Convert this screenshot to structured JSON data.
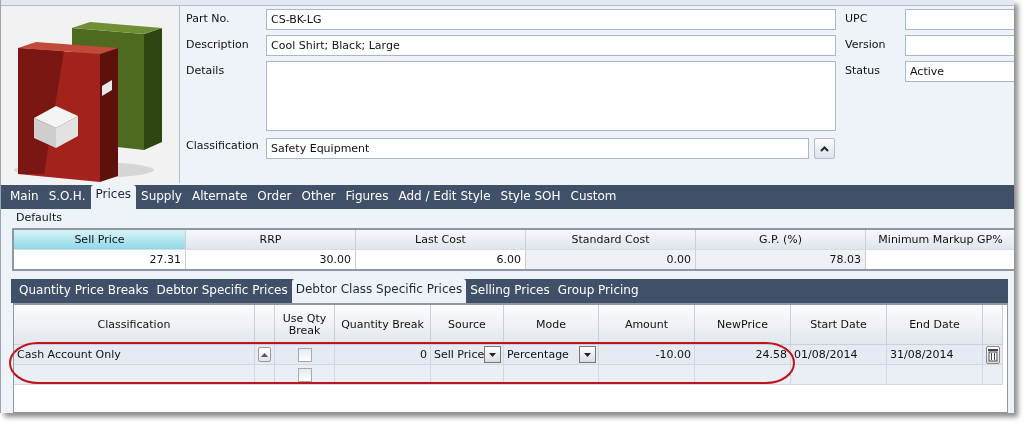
{
  "product": {
    "fields": [
      {
        "label": "Part No.",
        "value": "CS-BK-LG",
        "kind": "text"
      },
      {
        "label": "Description",
        "value": "Cool Shirt; Black; Large",
        "kind": "text"
      },
      {
        "label": "Details",
        "kind": "textarea"
      },
      {
        "label": "Classification",
        "value": "Safety Equipment",
        "kind": "lookup"
      }
    ],
    "side_fields": [
      {
        "label": "UPC"
      },
      {
        "label": "Version"
      },
      {
        "label": "Status",
        "value": "Active"
      }
    ]
  },
  "main_tabs": [
    {
      "label": "Main",
      "selected": false
    },
    {
      "label": "S.O.H.",
      "selected": false
    },
    {
      "label": "Prices",
      "selected": true
    },
    {
      "label": "Supply",
      "selected": false
    },
    {
      "label": "Alternate",
      "selected": false
    },
    {
      "label": "Order",
      "selected": false
    },
    {
      "label": "Other",
      "selected": false
    },
    {
      "label": "Figures",
      "selected": false
    },
    {
      "label": "Add / Edit Style",
      "selected": false
    },
    {
      "label": "Style SOH",
      "selected": false
    },
    {
      "label": "Custom",
      "selected": false
    }
  ],
  "defaults": {
    "title": "Defaults",
    "columns": [
      {
        "header": "Sell Price",
        "value": "27.31",
        "selected": true,
        "editable": true
      },
      {
        "header": "RRP",
        "value": "30.00",
        "selected": false,
        "editable": true
      },
      {
        "header": "Last Cost",
        "value": "6.00",
        "selected": false,
        "editable": true
      },
      {
        "header": "Standard Cost",
        "value": "0.00",
        "selected": false,
        "editable": false
      },
      {
        "header": "G.P. (%)",
        "value": "78.03",
        "selected": false,
        "editable": false
      },
      {
        "header": "Minimum Markup GP%",
        "selected": false,
        "editable": true
      }
    ]
  },
  "sub_tabs": [
    {
      "label": "Quantity Price Breaks",
      "selected": false
    },
    {
      "label": "Debtor Specific Prices",
      "selected": false
    },
    {
      "label": "Debtor Class Specific Prices",
      "selected": true
    },
    {
      "label": "Selling Prices",
      "selected": false
    },
    {
      "label": "Group Pricing",
      "selected": false
    }
  ],
  "table": {
    "columns": [
      {
        "header": "Classification"
      },
      {},
      {
        "header": "Use Qty Break"
      },
      {
        "header": "Quantity Break"
      },
      {
        "header": "Source"
      },
      {
        "header": "Mode"
      },
      {
        "header": "Amount"
      },
      {
        "header": "NewPrice"
      },
      {
        "header": "Start Date"
      },
      {
        "header": "End Date"
      },
      {}
    ],
    "rows": [
      {
        "cells": [
          {
            "kind": "text",
            "value": "Cash Account Only"
          },
          {
            "kind": "lookup-button"
          },
          {
            "kind": "checkbox",
            "checked": false
          },
          {
            "kind": "text",
            "value": "0"
          },
          {
            "kind": "dropdown",
            "value": "Sell Price"
          },
          {
            "kind": "dropdown",
            "value": "Percentage"
          },
          {
            "kind": "text",
            "value": "-10.00"
          },
          {
            "kind": "text",
            "value": "24.58"
          },
          {
            "kind": "text",
            "value": "01/08/2014"
          },
          {
            "kind": "text",
            "value": "31/08/2014"
          },
          {
            "kind": "delete-button"
          }
        ]
      },
      {
        "cells": [
          {
            "kind": "empty"
          },
          {
            "kind": "empty"
          },
          {
            "kind": "checkbox",
            "checked": false
          },
          {
            "kind": "empty"
          },
          {
            "kind": "empty"
          },
          {
            "kind": "empty"
          },
          {
            "kind": "empty"
          },
          {
            "kind": "empty"
          },
          {
            "kind": "empty"
          },
          {
            "kind": "empty"
          },
          {
            "kind": "empty"
          }
        ]
      }
    ],
    "annotations": [
      {
        "kind": "ellipse"
      }
    ]
  }
}
